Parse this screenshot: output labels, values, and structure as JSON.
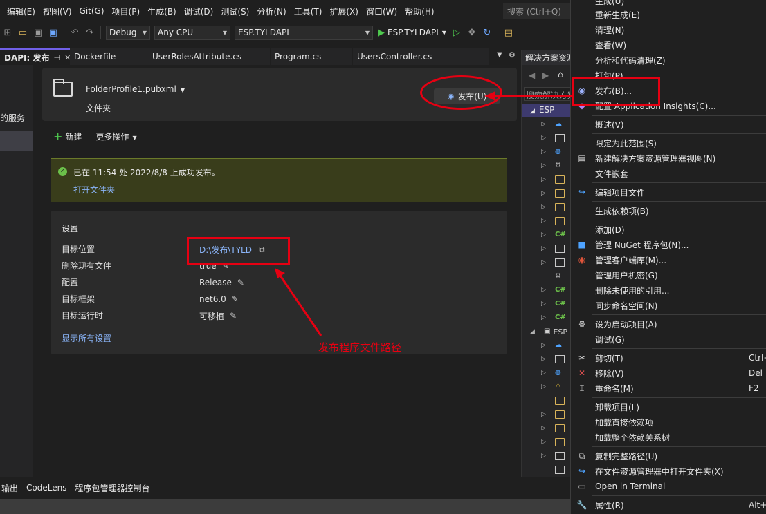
{
  "menubar": {
    "items": [
      "编辑(E)",
      "视图(V)",
      "Git(G)",
      "项目(P)",
      "生成(B)",
      "调试(D)",
      "测试(S)",
      "分析(N)",
      "工具(T)",
      "扩展(X)",
      "窗口(W)",
      "帮助(H)"
    ],
    "search_placeholder": "搜索 (Ctrl+Q)"
  },
  "toolbar": {
    "config": "Debug",
    "platform": "Any CPU",
    "project": "ESP.TYLDAPI",
    "run_target": "ESP.TYLDAPI"
  },
  "tabs": {
    "active": "DAPI: 发布",
    "others": [
      "Dockerfile",
      "UserRolesAttribute.cs",
      "Program.cs",
      "UsersController.cs"
    ]
  },
  "left_panel": {
    "services_label": "的服务"
  },
  "publish": {
    "profile_name": "FolderProfile1.pubxml",
    "profile_type": "文件夹",
    "publish_button": "发布(U)",
    "new_label": "新建",
    "more_actions": "更多操作",
    "success_message": "已在 11:54 处 2022/8/8 上成功发布。",
    "open_folder": "打开文件夹",
    "settings_title": "设置",
    "settings": [
      {
        "key": "目标位置",
        "value": "D:\\发布\\TYLD"
      },
      {
        "key": "删除现有文件",
        "value": "true"
      },
      {
        "key": "配置",
        "value": "Release"
      },
      {
        "key": "目标框架",
        "value": "net6.0"
      },
      {
        "key": "目标运行时",
        "value": "可移植"
      }
    ],
    "show_all": "显示所有设置"
  },
  "annotation": {
    "text": "发布程序文件路径"
  },
  "solution_explorer": {
    "title": "解决方案资源",
    "search": "搜索解决方案",
    "root": "ESP",
    "second_root": "ESP"
  },
  "context_menu": {
    "items": [
      {
        "label": "生成(U)",
        "shortcut": ""
      },
      {
        "label": "重新生成(E)",
        "shortcut": ""
      },
      {
        "label": "清理(N)",
        "shortcut": ""
      },
      {
        "label": "查看(W)",
        "shortcut": ""
      },
      {
        "label": "分析和代码清理(Z)",
        "shortcut": ""
      },
      {
        "label": "打包(P)",
        "shortcut": ""
      },
      {
        "label": "发布(B)...",
        "shortcut": ""
      },
      {
        "label": "配置 Application Insights(C)...",
        "shortcut": ""
      },
      {
        "label": "概述(V)",
        "shortcut": ""
      },
      {
        "label": "限定为此范围(S)",
        "shortcut": ""
      },
      {
        "label": "新建解决方案资源管理器视图(N)",
        "shortcut": ""
      },
      {
        "label": "文件嵌套",
        "shortcut": ""
      },
      {
        "label": "编辑项目文件",
        "shortcut": ""
      },
      {
        "label": "生成依赖项(B)",
        "shortcut": ""
      },
      {
        "label": "添加(D)",
        "shortcut": ""
      },
      {
        "label": "管理 NuGet 程序包(N)...",
        "shortcut": ""
      },
      {
        "label": "管理客户端库(M)...",
        "shortcut": ""
      },
      {
        "label": "管理用户机密(G)",
        "shortcut": ""
      },
      {
        "label": "删除未使用的引用...",
        "shortcut": ""
      },
      {
        "label": "同步命名空间(N)",
        "shortcut": ""
      },
      {
        "label": "设为启动项目(A)",
        "shortcut": ""
      },
      {
        "label": "调试(G)",
        "shortcut": ""
      },
      {
        "label": "剪切(T)",
        "shortcut": "Ctrl+"
      },
      {
        "label": "移除(V)",
        "shortcut": "Del"
      },
      {
        "label": "重命名(M)",
        "shortcut": "F2"
      },
      {
        "label": "卸载项目(L)",
        "shortcut": ""
      },
      {
        "label": "加载直接依赖项",
        "shortcut": ""
      },
      {
        "label": "加载整个依赖关系树",
        "shortcut": ""
      },
      {
        "label": "复制完整路径(U)",
        "shortcut": ""
      },
      {
        "label": "在文件资源管理器中打开文件夹(X)",
        "shortcut": ""
      },
      {
        "label": "Open in Terminal",
        "shortcut": ""
      },
      {
        "label": "属性(R)",
        "shortcut": "Alt+"
      }
    ]
  },
  "bottom_tabs": [
    "输出",
    "CodeLens",
    "程序包管理器控制台"
  ],
  "colors": {
    "accent": "#7160e8",
    "annotation": "#e60012",
    "link": "#8ab4f8",
    "success_bg": "#393d1b"
  }
}
